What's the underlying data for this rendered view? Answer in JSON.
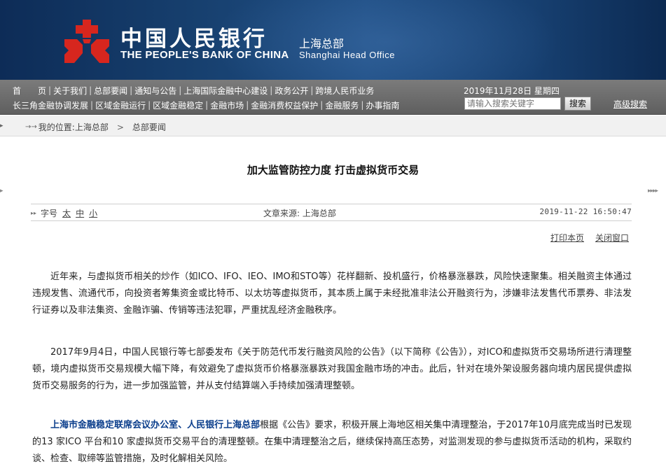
{
  "header": {
    "bank_name_cn": "中国人民银行",
    "bank_name_en": "THE PEOPLE'S BANK OF CHINA",
    "branch_cn": "上海总部",
    "branch_en": "Shanghai  Head  Office",
    "logo_color": "#d7261e",
    "banner_color": "#17406f"
  },
  "nav": {
    "row1": [
      "首　　页",
      "关于我们",
      "总部要闻",
      "通知与公告",
      "上海国际金融中心建设",
      "政务公开",
      "跨境人民币业务"
    ],
    "row2": [
      "长三角金融协调发展",
      "区域金融运行",
      "区域金融稳定",
      "金融市场",
      "金融消费权益保护",
      "金融服务",
      "办事指南"
    ],
    "separator": "|",
    "date": "2019年11月28日  星期四",
    "search_placeholder": "请输入搜索关键字",
    "search_button": "搜索",
    "advanced_search": "高级搜索"
  },
  "breadcrumb": {
    "corner": "▸",
    "arrow": "→→",
    "label": "我的位置: ",
    "items": [
      "上海总部",
      "总部要闻"
    ],
    "chevron": ">"
  },
  "edges": {
    "left": "▸",
    "right": "▸▸▸▸"
  },
  "article": {
    "title": "加大监管防控力度  打击虚拟货币交易",
    "font_icon": "▸▸",
    "font_label": "字号",
    "font_sizes": [
      "太",
      "中",
      "小"
    ],
    "source": "文章来源: 上海总部",
    "datetime": "2019-11-22  16:50:47",
    "print": "打印本页",
    "close": "关闭窗口",
    "p1": "近年来，与虚拟货币相关的炒作（如ICO、IFO、IEO、IMO和STO等）花样翻新、投机盛行，价格暴涨暴跌，风险快速聚集。相关融资主体通过违规发售、流通代币，向投资者筹集资金或比特币、以太坊等虚拟货币，其本质上属于未经批准非法公开融资行为，涉嫌非法发售代币票券、非法发行证券以及非法集资、金融诈骗、传销等违法犯罪，严重扰乱经济金融秩序。",
    "p2": "2017年9月4日，中国人民银行等七部委发布《关于防范代币发行融资风险的公告》（以下简称《公告》），对ICO和虚拟货币交易场所进行清理整顿，境内虚拟货币交易规模大幅下降，有效避免了虚拟货币价格暴涨暴跌对我国金融市场的冲击。此后，针对在境外架设服务器向境内居民提供虚拟货币交易服务的行为，进一步加强监管，并从支付结算端入手持续加强清理整顿。",
    "p3_highlight": "上海市金融稳定联席会议办公室、人民银行上海总部",
    "p3_rest": "根据《公告》要求，积极开展上海地区相关集中清理整治，于2017年10月底完成当时已发现的13 家ICO 平台和10 家虚拟货币交易平台的清理整顿。在集中清理整治之后，继续保持高压态势，对监测发现的参与虚拟货币活动的机构，采取约谈、检查、取缔等监管措施，及时化解相关风险。",
    "highlight_color": "#0b3e8c"
  }
}
